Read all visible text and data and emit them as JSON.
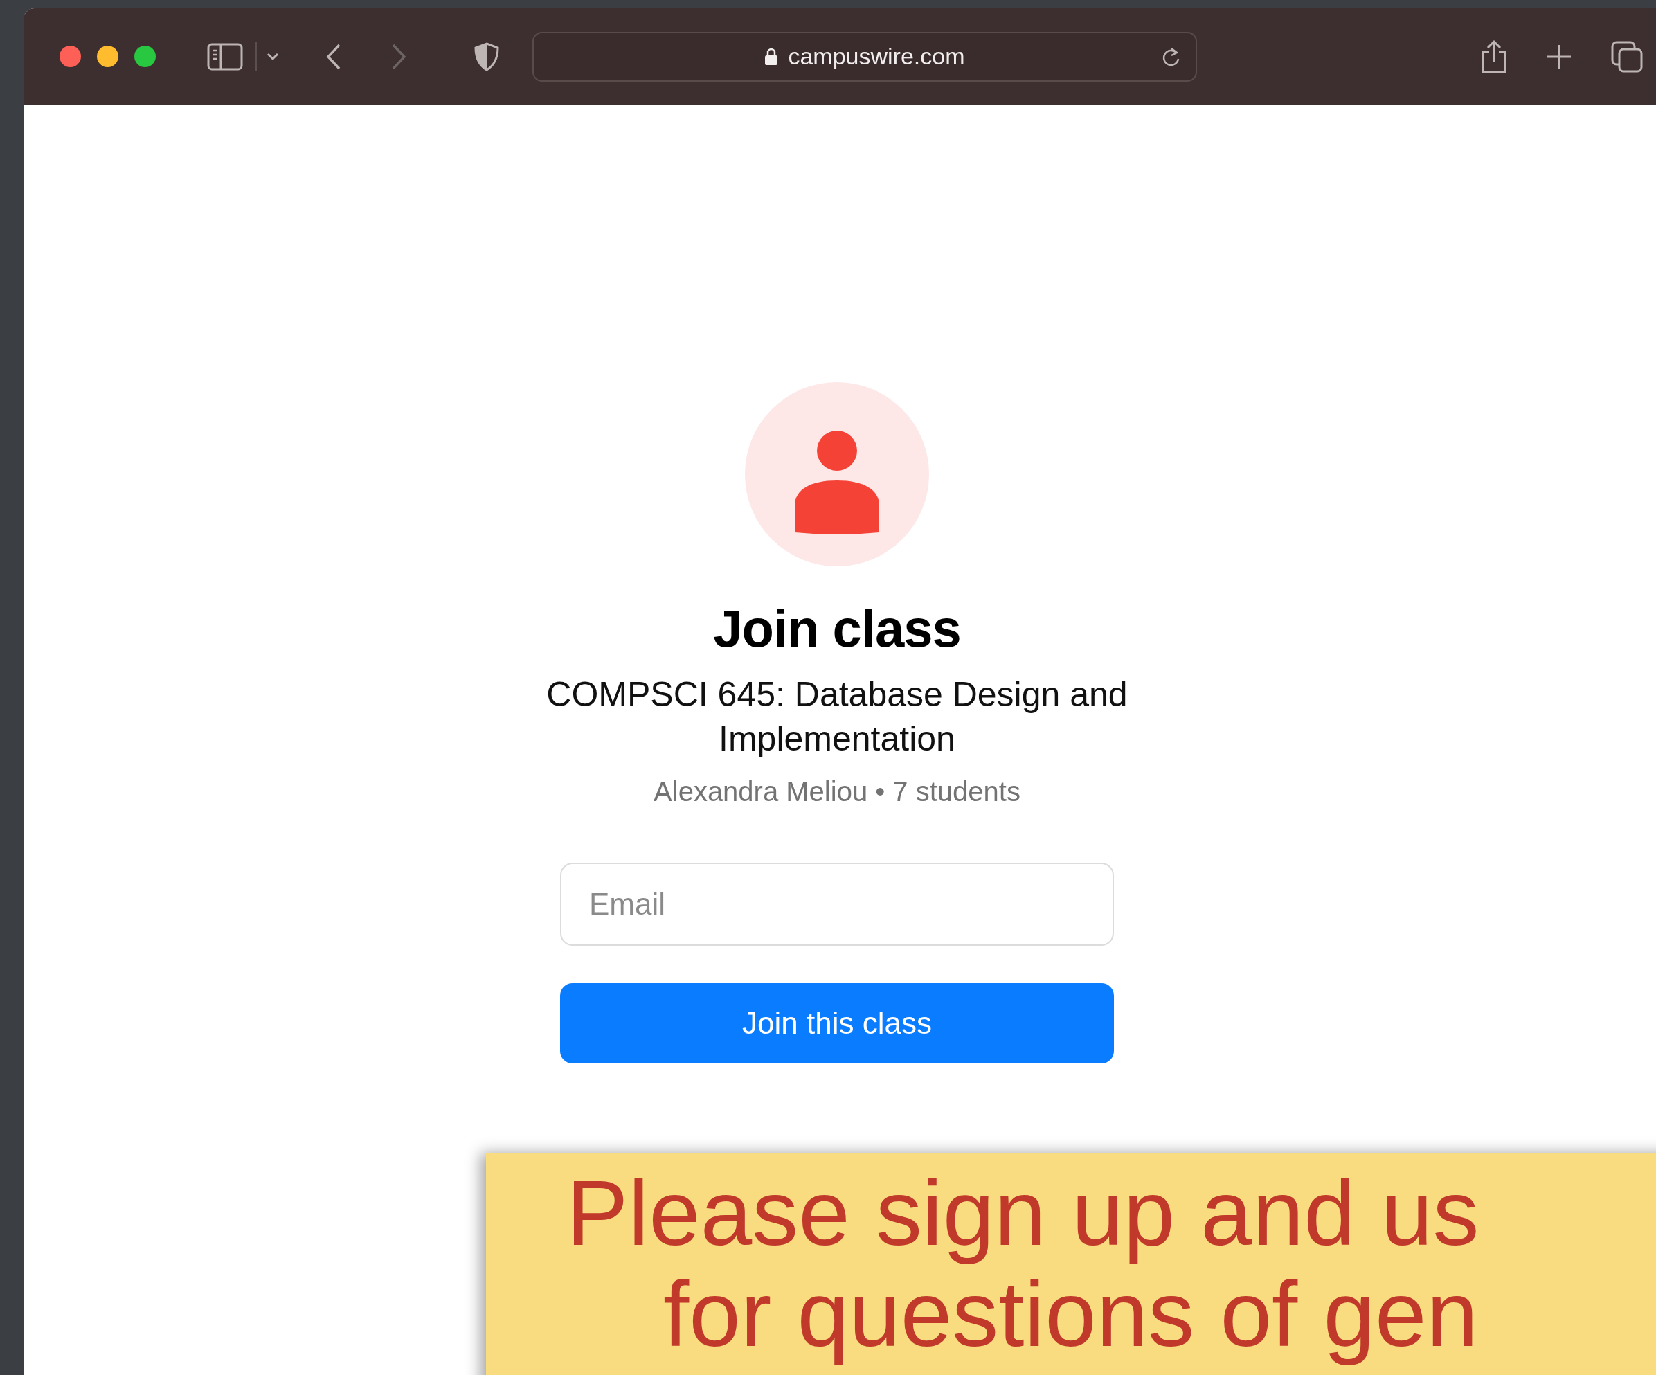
{
  "browser": {
    "back_enabled": true,
    "forward_enabled": false,
    "url": "campuswire.com"
  },
  "page": {
    "title": "Join class",
    "course": "COMPSCI 645: Database Design and Implementation",
    "meta": "Alexandra Meliou • 7 students",
    "email": {
      "placeholder": "Email"
    },
    "button": "Join this class"
  },
  "note": {
    "lines": [
      "Please sign up and us",
      "for questions of gen"
    ]
  }
}
